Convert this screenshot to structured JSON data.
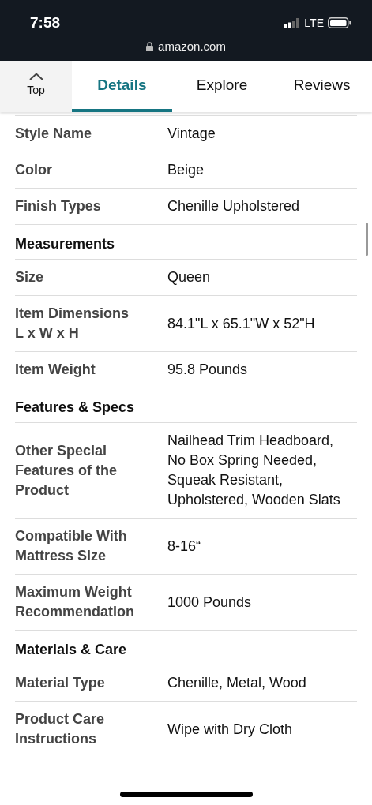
{
  "status_bar": {
    "time": "7:58",
    "network": "LTE",
    "url": "amazon.com"
  },
  "top_button": {
    "label": "Top"
  },
  "tabs": [
    {
      "label": "Details",
      "selected": true
    },
    {
      "label": "Explore",
      "selected": false
    },
    {
      "label": "Reviews",
      "selected": false
    }
  ],
  "rows": [
    {
      "kind": "row",
      "label": "Style Name",
      "value": "Vintage"
    },
    {
      "kind": "row",
      "label": "Color",
      "value": "Beige"
    },
    {
      "kind": "row",
      "label": "Finish Types",
      "value": "Chenille Upholstered"
    },
    {
      "kind": "heading",
      "label": "Measurements"
    },
    {
      "kind": "row",
      "label": "Size",
      "value": "Queen"
    },
    {
      "kind": "row",
      "label": "Item Dimensions\nL x W x H",
      "value": "84.1\"L x 65.1\"W x 52\"H"
    },
    {
      "kind": "row",
      "label": "Item Weight",
      "value": "95.8 Pounds"
    },
    {
      "kind": "heading",
      "label": "Features & Specs"
    },
    {
      "kind": "row",
      "label": "Other Special Features of the Product",
      "value": "Nailhead Trim Headboard, No Box Spring Needed, Squeak Resistant, Upholstered, Wooden Slats"
    },
    {
      "kind": "row",
      "label": "Compatible With Mattress Size",
      "value": "8-16“"
    },
    {
      "kind": "row",
      "label": "Maximum Weight Recommendation",
      "value": "1000 Pounds"
    },
    {
      "kind": "heading",
      "label": "Materials & Care"
    },
    {
      "kind": "row",
      "label": "Material Type",
      "value": "Chenille, Metal, Wood"
    },
    {
      "kind": "row",
      "label": "Product Care Instructions",
      "value": "Wipe with Dry Cloth"
    }
  ]
}
